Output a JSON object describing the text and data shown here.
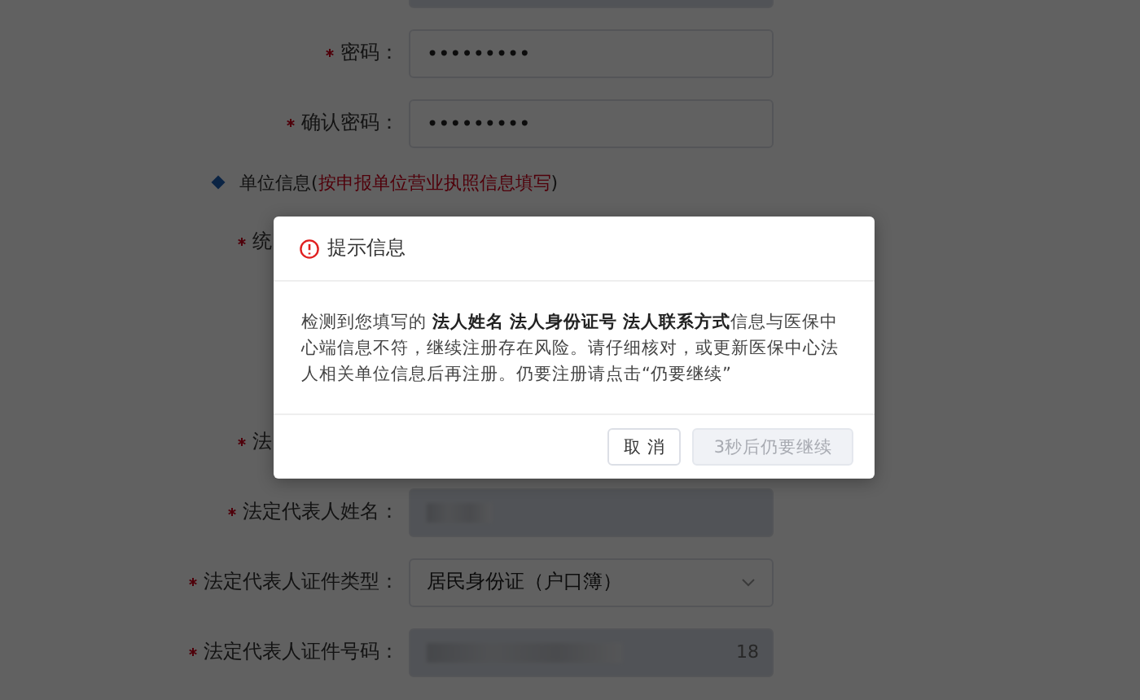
{
  "form": {
    "rows": [
      {
        "kind": "input",
        "disabled": true
      },
      {
        "kind": "input",
        "required": true,
        "label": "密码：",
        "value": "•••••••••",
        "disabled": false
      },
      {
        "kind": "input",
        "required": true,
        "label": "确认密码：",
        "value": "•••••••••",
        "disabled": false
      },
      {
        "kind": "section",
        "parts": [
          {
            "text": "单位信息(",
            "accent": false
          },
          {
            "text": "按申报单位营业执照信息填写",
            "accent": true
          },
          {
            "text": ")",
            "accent": false
          }
        ]
      },
      {
        "kind": "covered",
        "required": true,
        "label": "统"
      },
      {
        "kind": "covered",
        "required": true,
        "label": "法"
      },
      {
        "kind": "masked",
        "required": true,
        "label": "法定代表人姓名：",
        "disabled": true
      },
      {
        "kind": "select",
        "required": true,
        "label": "法定代表人证件类型：",
        "value": "居民身份证（户口簿）"
      },
      {
        "kind": "masked",
        "required": true,
        "label": "法定代表人证件号码：",
        "disabled": true,
        "count": "18"
      }
    ]
  },
  "dialog": {
    "title": "提示信息",
    "message": "检测到您填写的 **法人姓名 法人身份证号 法人联系方式**信息与医保中心端信息不符，继续注册存在风险。请仔细核对，或更新医保中心法人相关单位信息后再注册。仍要注册请点击“仍要继续”",
    "buttons": [
      {
        "label": "取 消",
        "disabled": false
      },
      {
        "label": "3秒后仍要继续",
        "disabled": true
      }
    ]
  }
}
